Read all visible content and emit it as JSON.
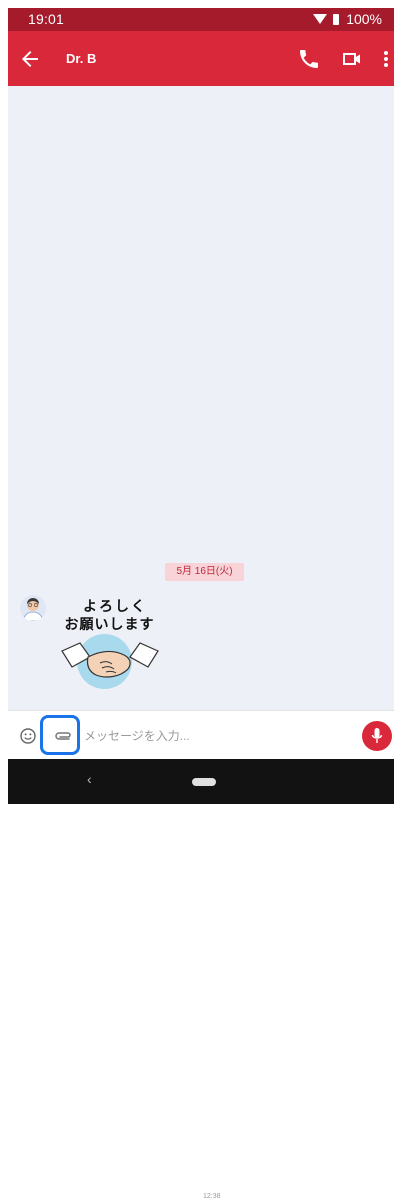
{
  "status_bar": {
    "time": "19:01",
    "battery": "100%"
  },
  "app_bar": {
    "title": "Dr. B"
  },
  "chat": {
    "date_chip": "5月 16日(火)",
    "sticker_line1": "よろしく",
    "sticker_line2": "お願いします",
    "time": "12:38"
  },
  "input": {
    "placeholder": "メッセージを入力..."
  },
  "colors": {
    "primary": "#d9283a",
    "status_bar": "#a51b2b",
    "highlight": "#1a73e8",
    "chat_bg": "#eef0f7"
  },
  "icons": [
    "back-arrow-icon",
    "phone-icon",
    "video-icon",
    "more-vert-icon",
    "emoji-icon",
    "attach-icon",
    "mic-icon",
    "nav-back-icon",
    "nav-home-icon"
  ]
}
